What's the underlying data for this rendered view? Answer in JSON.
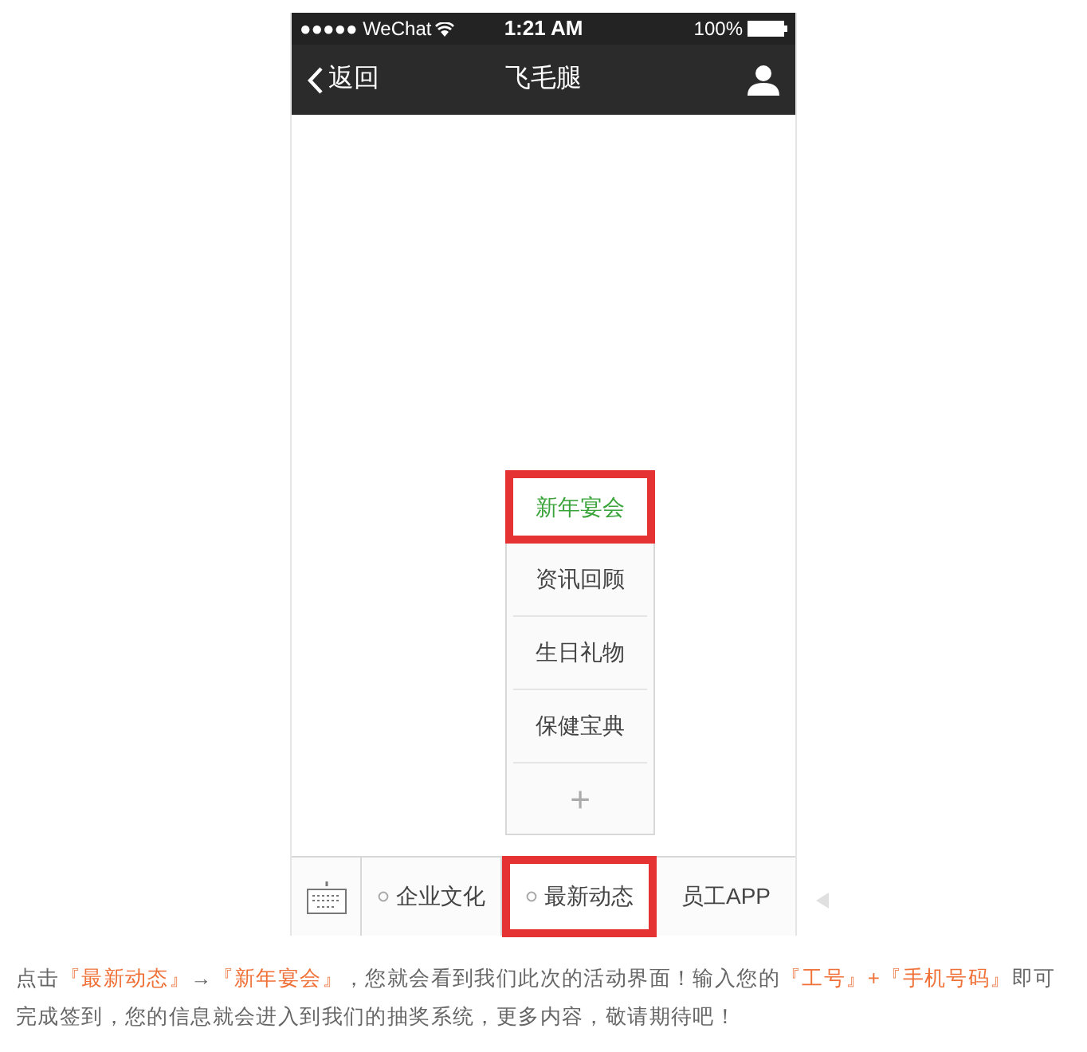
{
  "status_bar": {
    "carrier": "●●●●● WeChat",
    "time": "1:21 AM",
    "battery": "100%"
  },
  "nav_bar": {
    "back": "返回",
    "title": "飞毛腿"
  },
  "submenu": {
    "items": [
      {
        "label": "新年宴会",
        "selected": true,
        "highlighted": true
      },
      {
        "label": "资讯回顾",
        "selected": false,
        "highlighted": false
      },
      {
        "label": "生日礼物",
        "selected": false,
        "highlighted": false
      },
      {
        "label": "保健宝典",
        "selected": false,
        "highlighted": false
      }
    ],
    "add": "+"
  },
  "menu_bar": {
    "items": [
      {
        "label": "企业文化",
        "has_submenu": true,
        "highlighted": false
      },
      {
        "label": "最新动态",
        "has_submenu": true,
        "highlighted": true
      },
      {
        "label": "员工APP",
        "has_submenu": false,
        "highlighted": false
      }
    ]
  },
  "caption": [
    {
      "text": "点击",
      "highlight": false
    },
    {
      "text": "『最新动态』",
      "highlight": true
    },
    {
      "text": "→",
      "highlight": false
    },
    {
      "text": "『新年宴会』",
      "highlight": true
    },
    {
      "text": "，您就会看到我们此次的活动界面！输入您的",
      "highlight": false
    },
    {
      "text": "『工号』+『手机号码』",
      "highlight": true
    },
    {
      "text": "即可完成签到，您的信息就会进入到我们的抽奖系统，更多内容，敬请期待吧！",
      "highlight": false
    }
  ]
}
